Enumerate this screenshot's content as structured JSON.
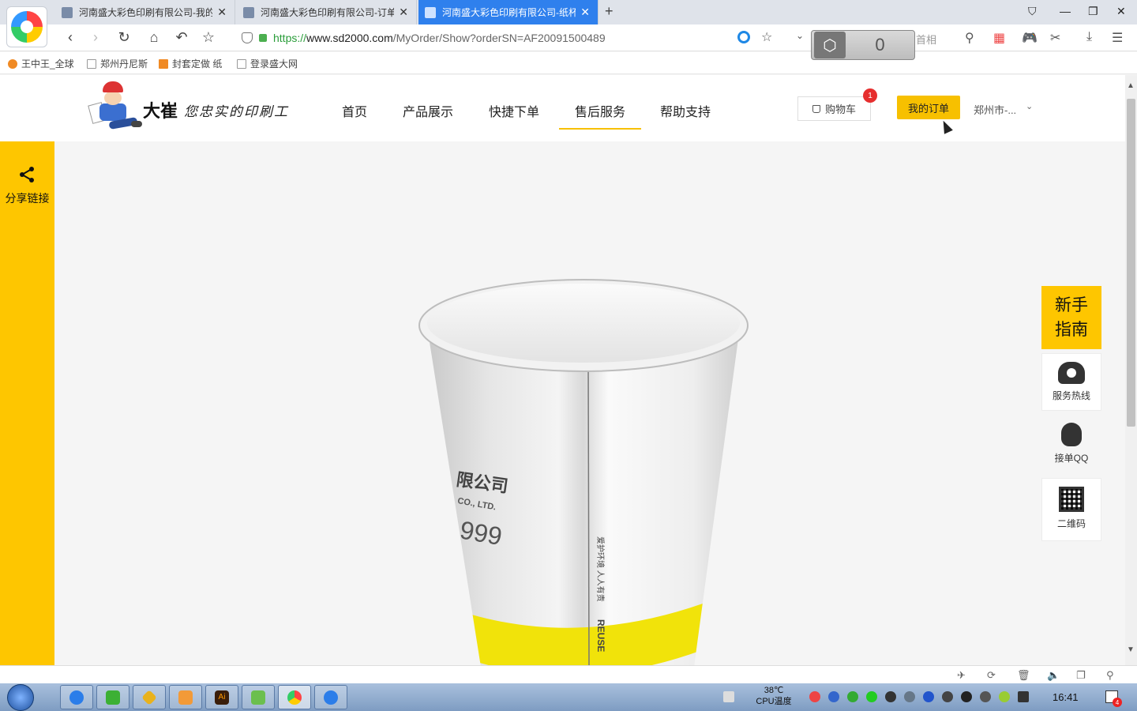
{
  "browser": {
    "tabs": [
      {
        "title": "河南盛大彩色印刷有限公司-我的"
      },
      {
        "title": "河南盛大彩色印刷有限公司-订单"
      },
      {
        "title": "河南盛大彩色印刷有限公司-纸杯"
      }
    ],
    "new_tab_symbol": "+",
    "window_controls": {
      "minimize": "—",
      "maximize": "❐",
      "close": "✕"
    },
    "url": {
      "protocol": "https://",
      "host": "www.sd2000.com",
      "path": "/MyOrder/Show?orderSN=AF20091500489"
    },
    "extension_counter": "0",
    "search_placeholder": "首相",
    "bookmarks": [
      "王中王_全球",
      "郑州丹尼斯",
      "封套定做 纸",
      "登录盛大网"
    ]
  },
  "site": {
    "brand": "大崔",
    "slogan": "您忠实的印刷工",
    "nav": [
      "首页",
      "产品展示",
      "快捷下单",
      "售后服务",
      "帮助支持"
    ],
    "active_nav": "售后服务",
    "cart_label": "购物车",
    "cart_count": "1",
    "my_order_label": "我的订单",
    "city": "郑州市-...",
    "share_label": "分享链接",
    "float": {
      "guide": "新手指南",
      "hotline": "服务热线",
      "qq": "接单QQ",
      "qrcode": "二维码"
    },
    "cup_print": {
      "company": "限公司",
      "company_en": "CO., LTD.",
      "phone": "999",
      "vertical_cn": "爱护环境 人人有责",
      "vertical_en": "REUSE"
    },
    "colors": {
      "accent": "#fec600",
      "badge": "#e62e2e"
    }
  },
  "taskbar": {
    "temp": "38℃",
    "temp_label": "CPU温度",
    "clock": "16:41",
    "notif_count": "4"
  }
}
